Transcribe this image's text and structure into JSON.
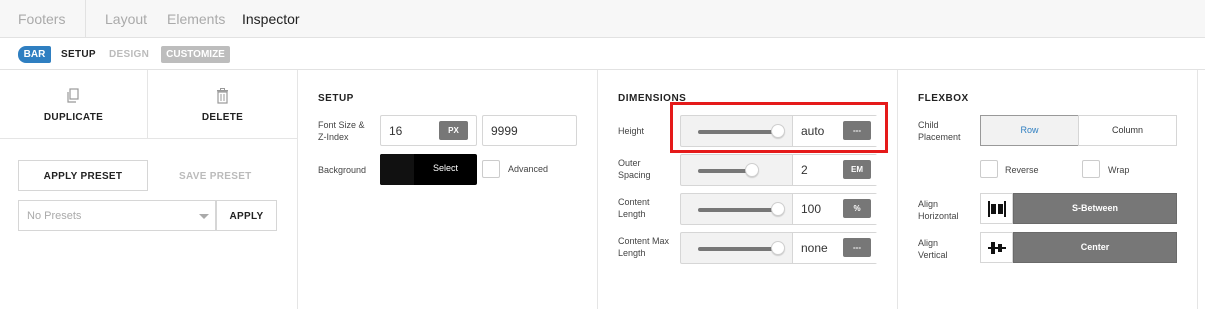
{
  "breadcrumbs": [
    "Footers",
    "Layout",
    "Elements",
    "Inspector"
  ],
  "subnav": {
    "badge": "BAR",
    "tabs": [
      "SETUP",
      "DESIGN",
      "CUSTOMIZE"
    ]
  },
  "left_panel": {
    "duplicate_label": "DUPLICATE",
    "delete_label": "DELETE",
    "apply_preset_label": "APPLY PRESET",
    "save_preset_label": "SAVE PRESET",
    "presets_select": "No Presets",
    "apply_label": "APPLY"
  },
  "setup": {
    "title": "SETUP",
    "font_label": "Font Size &\nZ-Index",
    "font_size": "16",
    "font_unit": "PX",
    "z_index": "9999",
    "background_label": "Background",
    "select_label": "Select",
    "advanced_label": "Advanced"
  },
  "dimensions": {
    "title": "DIMENSIONS",
    "rows": [
      {
        "label": "Height",
        "value": "auto",
        "unit": "---",
        "level": 1.0
      },
      {
        "label": "Outer\nSpacing",
        "value": "2",
        "unit": "EM",
        "level": 0.68
      },
      {
        "label": "Content\nLength",
        "value": "100",
        "unit": "%",
        "level": 1.0
      },
      {
        "label": "Content Max\nLength",
        "value": "none",
        "unit": "---",
        "level": 1.0
      }
    ]
  },
  "flexbox": {
    "title": "FLEXBOX",
    "child_placement_label": "Child\nPlacement",
    "row_label": "Row",
    "column_label": "Column",
    "reverse_label": "Reverse",
    "wrap_label": "Wrap",
    "align_h_label": "Align\nHorizontal",
    "align_h_value": "S-Between",
    "align_v_label": "Align\nVertical",
    "align_v_value": "Center"
  },
  "colors": {
    "accent": "#2f7fc1",
    "highlight": "#e51a1a",
    "unit_bg": "#777777"
  }
}
